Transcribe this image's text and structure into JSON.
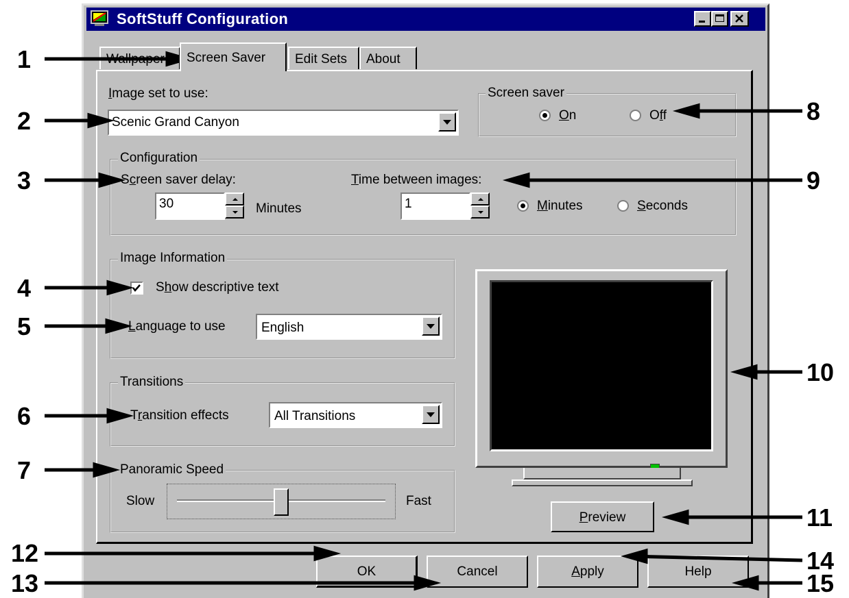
{
  "window": {
    "title": "SoftStuff Configuration",
    "controls": [
      "minimize-icon",
      "maximize-icon",
      "close-icon"
    ],
    "title_bg": "#000080"
  },
  "tabs": [
    {
      "label": "Wallpaper",
      "active": false
    },
    {
      "label": "Screen Saver",
      "active": true
    },
    {
      "label": "Edit Sets",
      "active": false
    },
    {
      "label": "About",
      "active": false
    }
  ],
  "image_set": {
    "label_pre": "",
    "label_ul": "I",
    "label_post": "mage set to use:",
    "value": "Scenic Grand Canyon"
  },
  "screen_saver": {
    "group_title": "Screen saver",
    "on_pre": "",
    "on_ul": "O",
    "on_post": "n",
    "off_pre": "O",
    "off_ul": "f",
    "off_post": "f",
    "selected": "On"
  },
  "configuration": {
    "group_title": "Configuration",
    "delay_pre": "S",
    "delay_ul": "c",
    "delay_post": "reen saver delay:",
    "delay_value": "30",
    "delay_unit": "Minutes",
    "between_pre": "",
    "between_ul": "T",
    "between_post": "ime between images:",
    "between_value": "1",
    "minutes_pre": "",
    "minutes_ul": "M",
    "minutes_post": "inutes",
    "seconds_pre": "",
    "seconds_ul": "S",
    "seconds_post": "econds",
    "unit_selected": "Minutes"
  },
  "image_info": {
    "group_title": "Image Information",
    "show_text_pre": "S",
    "show_text_ul": "h",
    "show_text_post": "ow descriptive text",
    "show_text_checked": true,
    "language_pre": "",
    "language_ul": "L",
    "language_post": "anguage to use",
    "language_value": "English"
  },
  "transitions": {
    "group_title": "Transitions",
    "effects_pre": "T",
    "effects_ul": "r",
    "effects_post": "ansition effects",
    "effects_value": "All Transitions"
  },
  "panoramic": {
    "group_title": "Panoramic Speed",
    "slow": "Slow",
    "fast": "Fast",
    "level": 0.5
  },
  "preview": {
    "pre": "",
    "ul": "P",
    "post": "review",
    "screen_color": "#000000",
    "led_color": "#00c000"
  },
  "buttons": {
    "ok": "OK",
    "cancel": "Cancel",
    "apply_pre": "",
    "apply_ul": "A",
    "apply_post": "pply",
    "help": "Help"
  },
  "callouts": [
    "1",
    "2",
    "3",
    "4",
    "5",
    "6",
    "7",
    "8",
    "9",
    "10",
    "11",
    "12",
    "13",
    "14",
    "15"
  ]
}
